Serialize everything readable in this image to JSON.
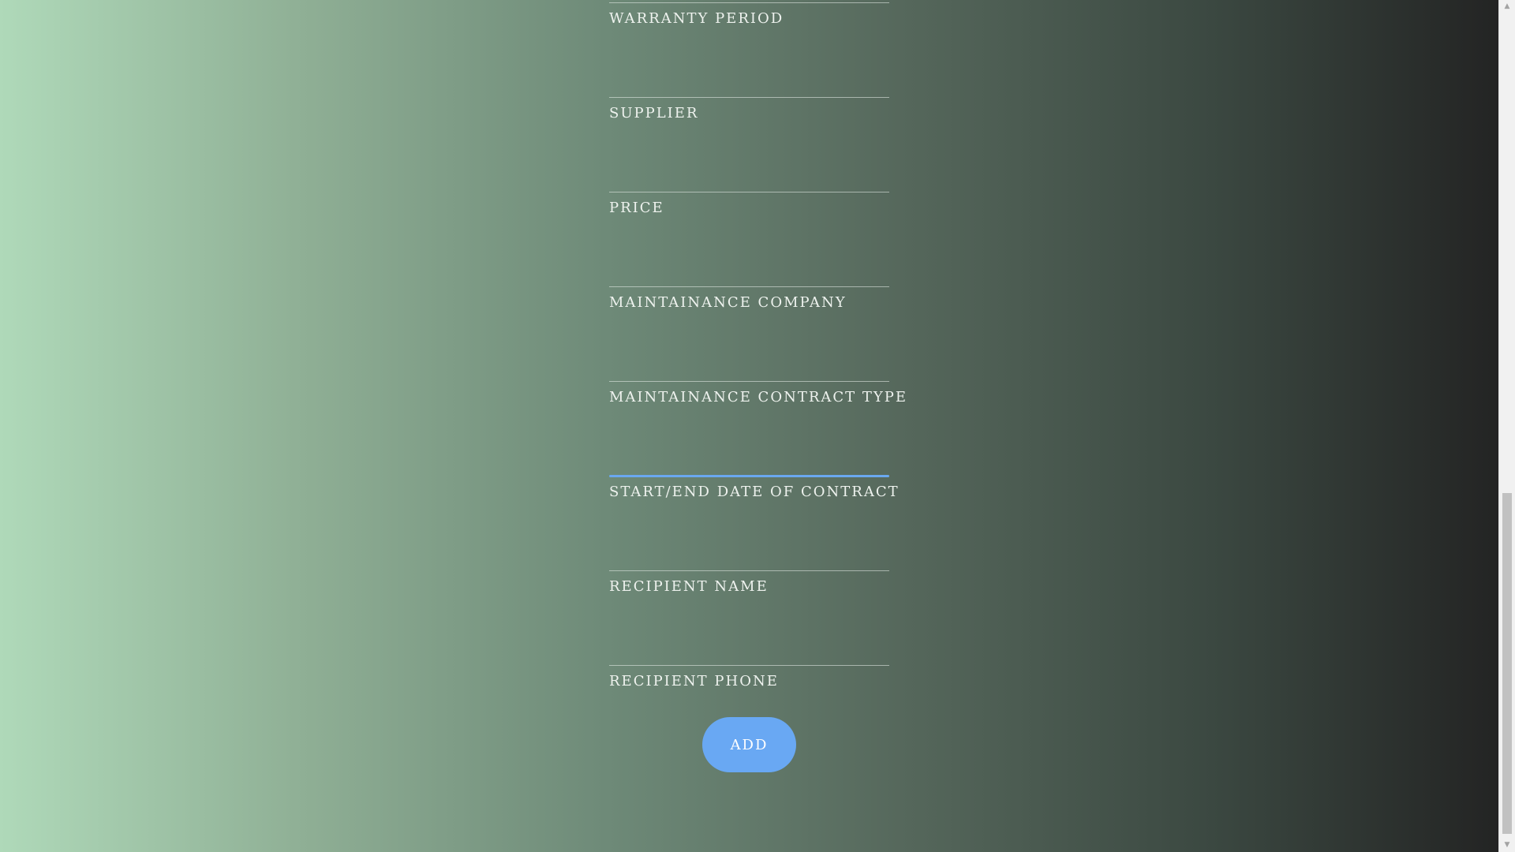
{
  "form": {
    "fields": [
      {
        "label": "WARRANTY PERIOD",
        "value": ""
      },
      {
        "label": "SUPPLIER",
        "value": ""
      },
      {
        "label": "PRICE",
        "value": ""
      },
      {
        "label": "MAINTAINANCE COMPANY",
        "value": ""
      },
      {
        "label": "MAINTAINANCE CONTRACT TYPE",
        "value": ""
      },
      {
        "label": "START/END DATE OF CONTRACT",
        "value": ""
      },
      {
        "label": "RECIPIENT NAME",
        "value": ""
      },
      {
        "label": "RECIPIENT PHONE",
        "value": ""
      }
    ],
    "submit_label": "ADD"
  },
  "scrollbar": {
    "up_arrow": "▲",
    "down_arrow": "▼"
  },
  "colors": {
    "accent": "#69a8f3",
    "gradient_start": "#afd9b9",
    "gradient_end": "#222222"
  }
}
